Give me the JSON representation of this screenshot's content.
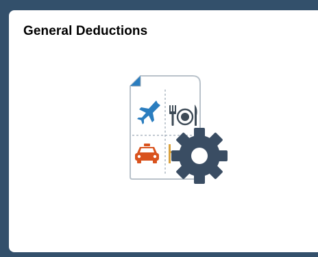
{
  "tile": {
    "title": "General Deductions",
    "icon": "expense-report-settings-icon",
    "accent_color": "#33506b",
    "airplane_color": "#2a7dbf",
    "utensils_color": "#3d4a56",
    "taxi_color": "#d9531e",
    "gear_color": "#3a4d63"
  }
}
